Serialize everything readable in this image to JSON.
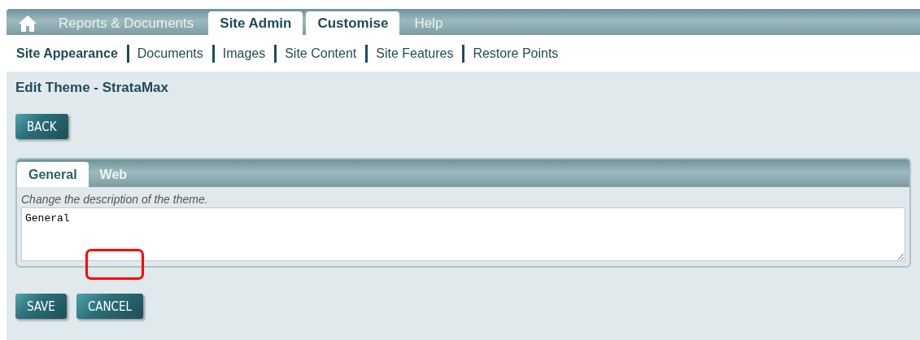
{
  "main_nav": {
    "tabs": [
      {
        "kind": "home",
        "selected": false
      },
      {
        "kind": "text",
        "label": "Reports & Documents",
        "selected": false
      },
      {
        "kind": "text",
        "label": "Site Admin",
        "selected": true
      },
      {
        "kind": "text",
        "label": "Customise",
        "selected": true
      },
      {
        "kind": "text",
        "label": "Help",
        "selected": false
      }
    ]
  },
  "sub_nav": {
    "items": [
      {
        "label": "Site Appearance",
        "selected": true
      },
      {
        "label": "Documents",
        "selected": false
      },
      {
        "label": "Images",
        "selected": false
      },
      {
        "label": "Site Content",
        "selected": false
      },
      {
        "label": "Site Features",
        "selected": false
      },
      {
        "label": "Restore Points",
        "selected": false
      }
    ]
  },
  "page_title": "Edit Theme - StrataMax",
  "back_button": "BACK",
  "panel": {
    "tabs": [
      {
        "label": "General",
        "selected": true
      },
      {
        "label": "Web",
        "selected": false
      }
    ],
    "hint": "Change the description of the theme.",
    "description": "General"
  },
  "buttons": [
    "SAVE",
    "CANCEL"
  ]
}
